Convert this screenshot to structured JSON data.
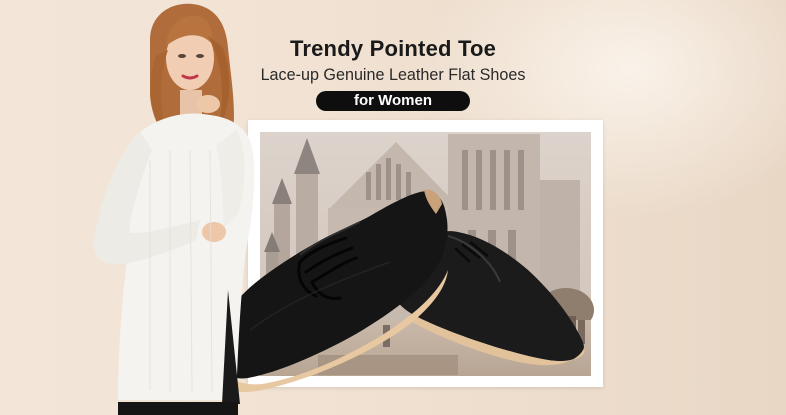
{
  "headline": {
    "title": "Trendy Pointed Toe",
    "subtitle": "Lace-up Genuine Leather Flat Shoes",
    "tag": "for Women"
  },
  "colors": {
    "background": "#f1e2d3",
    "pill": "#0e0e0e",
    "shoe": "#111111",
    "sole": "#e7c7a0",
    "sweater": "#f4f3ef",
    "hair": "#b8733f"
  },
  "images": {
    "model": "woman-in-white-sweater-photo",
    "scene": "castle-facade-photo",
    "product": "black-leather-lace-up-shoes-photo"
  }
}
